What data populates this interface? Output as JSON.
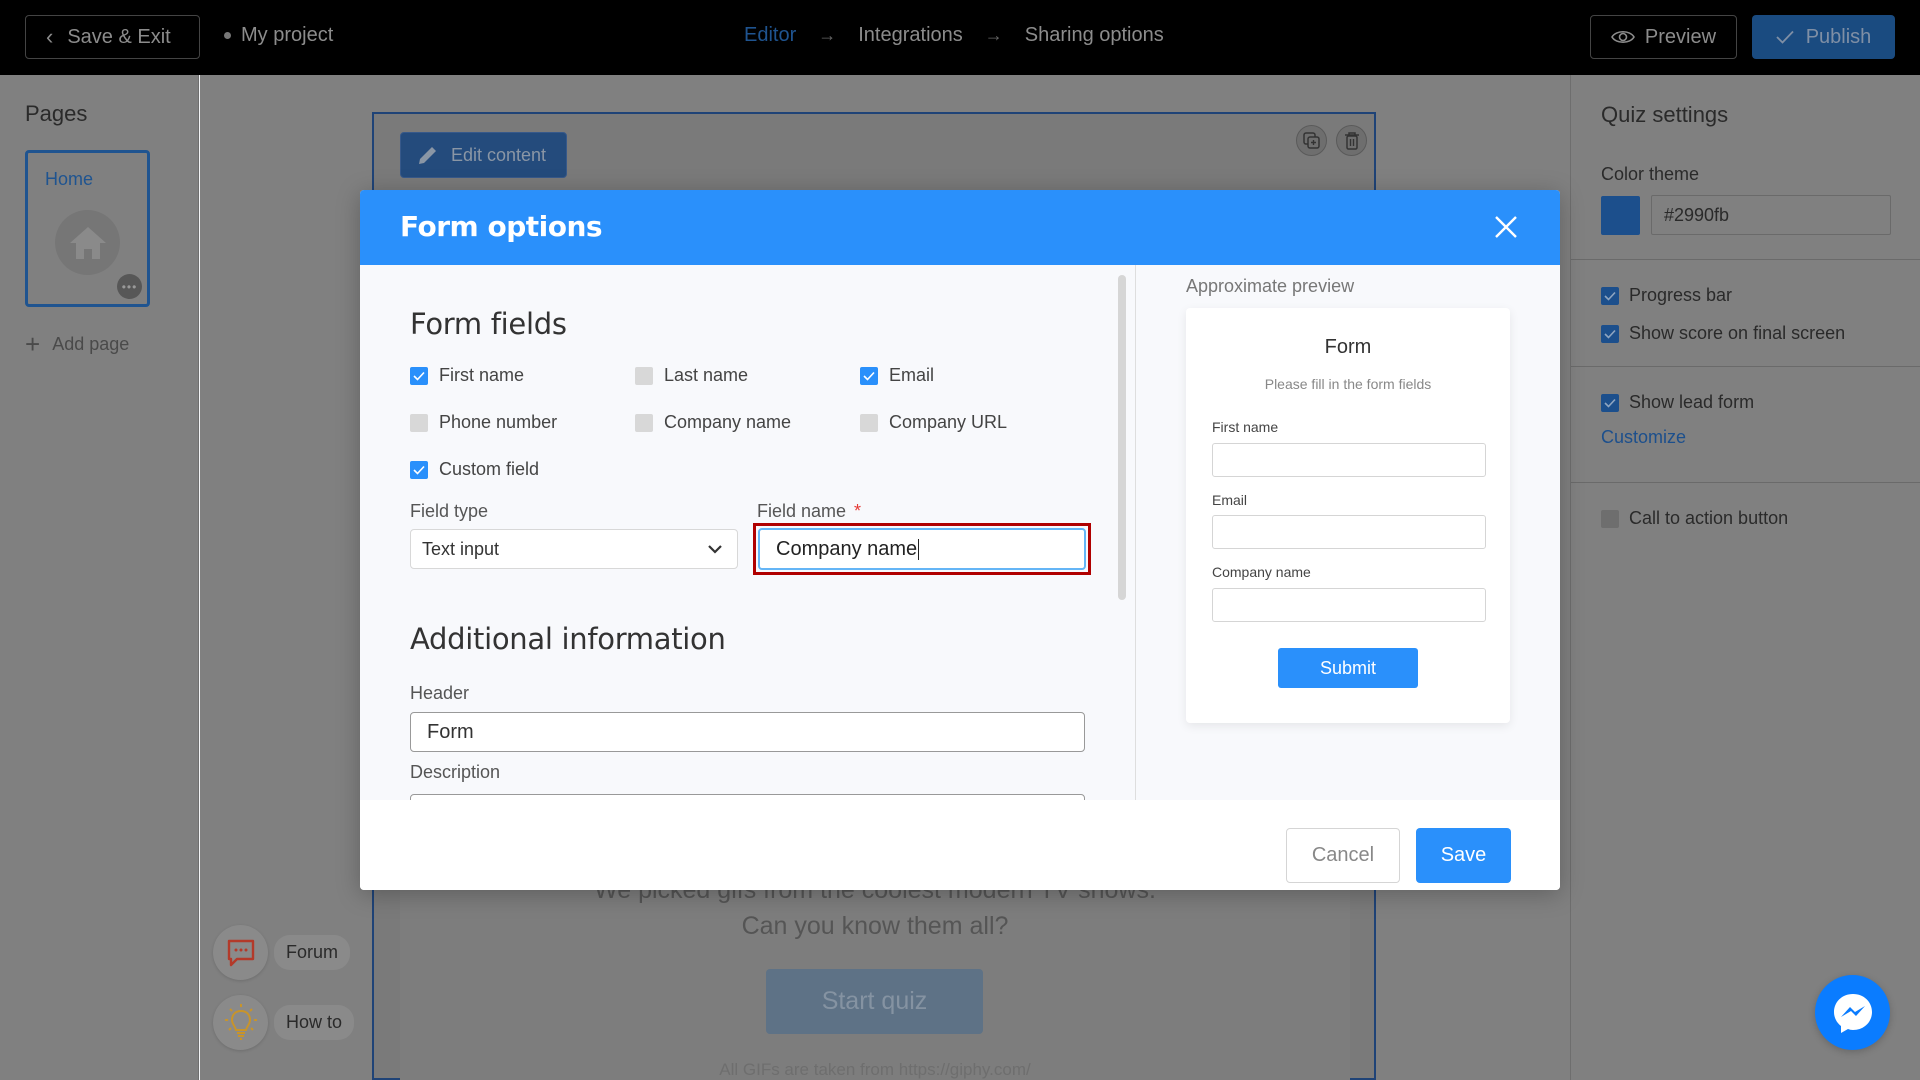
{
  "topbar": {
    "save_exit_label": "Save & Exit",
    "project_name": "My project",
    "breadcrumbs": [
      {
        "label": "Editor",
        "active": true
      },
      {
        "label": "Integrations",
        "active": false
      },
      {
        "label": "Sharing options",
        "active": false
      }
    ],
    "preview_label": "Preview",
    "publish_label": "Publish"
  },
  "left_sidebar": {
    "title": "Pages",
    "pages": [
      {
        "label": "Home"
      }
    ],
    "add_page_label": "Add page"
  },
  "canvas": {
    "edit_content_label": "Edit content",
    "subtitle_line1": "We picked gifs from the coolest modern TV shows.",
    "subtitle_line2": "Can you know them all?",
    "start_button_label": "Start quiz",
    "footer_note": "All GIFs are taken from https://giphy.com/"
  },
  "help": {
    "forum_label": "Forum",
    "howto_label": "How to"
  },
  "right_sidebar": {
    "title": "Quiz settings",
    "color_theme_label": "Color theme",
    "color_theme_value": "#2990fb",
    "progress_bar": {
      "label": "Progress bar",
      "checked": true
    },
    "show_score": {
      "label": "Show score on final screen",
      "checked": true
    },
    "show_lead_form": {
      "label": "Show lead form",
      "checked": true
    },
    "customize_label": "Customize",
    "cta_button": {
      "label": "Call to action button",
      "checked": false
    }
  },
  "modal": {
    "title": "Form options",
    "form_fields_title": "Form fields",
    "fields": [
      {
        "label": "First name",
        "checked": true
      },
      {
        "label": "Last name",
        "checked": false
      },
      {
        "label": "Email",
        "checked": true
      },
      {
        "label": "Phone number",
        "checked": false
      },
      {
        "label": "Company name",
        "checked": false
      },
      {
        "label": "Company URL",
        "checked": false
      },
      {
        "label": "Custom field",
        "checked": true
      }
    ],
    "field_type_label": "Field type",
    "field_type_value": "Text input",
    "field_name_label": "Field name",
    "field_name_required": "*",
    "field_name_value": "Company name",
    "additional_title": "Additional information",
    "header_label": "Header",
    "header_value": "Form",
    "description_label": "Description",
    "preview": {
      "caption": "Approximate preview",
      "title": "Form",
      "description": "Please fill in the form fields",
      "fields": [
        "First name",
        "Email",
        "Company name"
      ],
      "submit_label": "Submit"
    },
    "cancel_label": "Cancel",
    "save_label": "Save"
  },
  "colors": {
    "accent": "#2a90fb",
    "highlight_outline": "#b00000",
    "required": "#e53935"
  }
}
